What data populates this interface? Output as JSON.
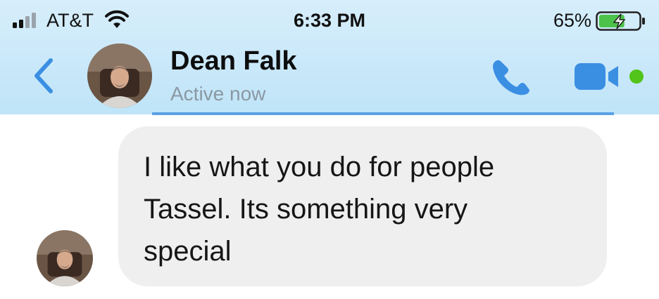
{
  "status_bar": {
    "carrier": "AT&T",
    "time": "6:33 PM",
    "battery_percent": "65%",
    "battery_level": 0.65,
    "icons": [
      "signal-icon",
      "wifi-icon",
      "battery-charging-icon"
    ]
  },
  "header": {
    "contact_name": "Dean Falk",
    "presence": "Active now",
    "icons": [
      "back-chevron-icon",
      "phone-icon",
      "video-camera-icon"
    ],
    "accent_color": "#3b8fe3",
    "online_color": "#52c41a"
  },
  "messages": [
    {
      "sender": "Dean Falk",
      "lines": [
        "I like what you do for people",
        "Tassel.  Its something very",
        "special"
      ]
    }
  ]
}
